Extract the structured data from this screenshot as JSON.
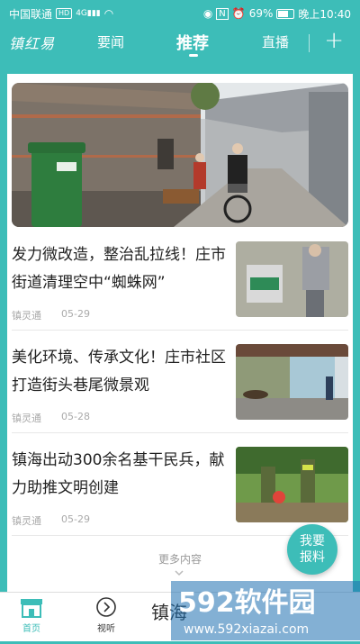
{
  "status_bar": {
    "carrier": "中国联通",
    "hd_badge": "HD",
    "signal_type": "4G",
    "battery": "69%",
    "time": "晚上10:40"
  },
  "top_nav": {
    "logo": "镇红易",
    "tabs": [
      {
        "label": "要闻",
        "active": false
      },
      {
        "label": "推荐",
        "active": true
      },
      {
        "label": "直播",
        "active": false
      }
    ],
    "plus_icon": "plus-icon"
  },
  "articles": [
    {
      "title": "发力微改造，整治乱拉线！庄市街道清理空中“蜘蛛网”",
      "source": "镇灵通",
      "date": "05-29"
    },
    {
      "title": "美化环境、传承文化！庄市社区打造街头巷尾微景观",
      "source": "镇灵通",
      "date": "05-28"
    },
    {
      "title": "镇海出动300余名基干民兵，献力助推文明创建",
      "source": "镇灵通",
      "date": "05-29"
    }
  ],
  "more_label": "更多内容",
  "report_button": {
    "line1": "我要",
    "line2": "报料"
  },
  "bottom_nav": [
    {
      "label": "首页",
      "icon": "home-icon",
      "active": true
    },
    {
      "label": "视听",
      "icon": "play-icon",
      "active": false
    },
    {
      "label": "镇海",
      "icon": "",
      "active": false
    }
  ],
  "watermark": {
    "brand": "592软件园",
    "url": "www.592xiazai.com"
  },
  "colors": {
    "accent": "#3dbdb8"
  }
}
